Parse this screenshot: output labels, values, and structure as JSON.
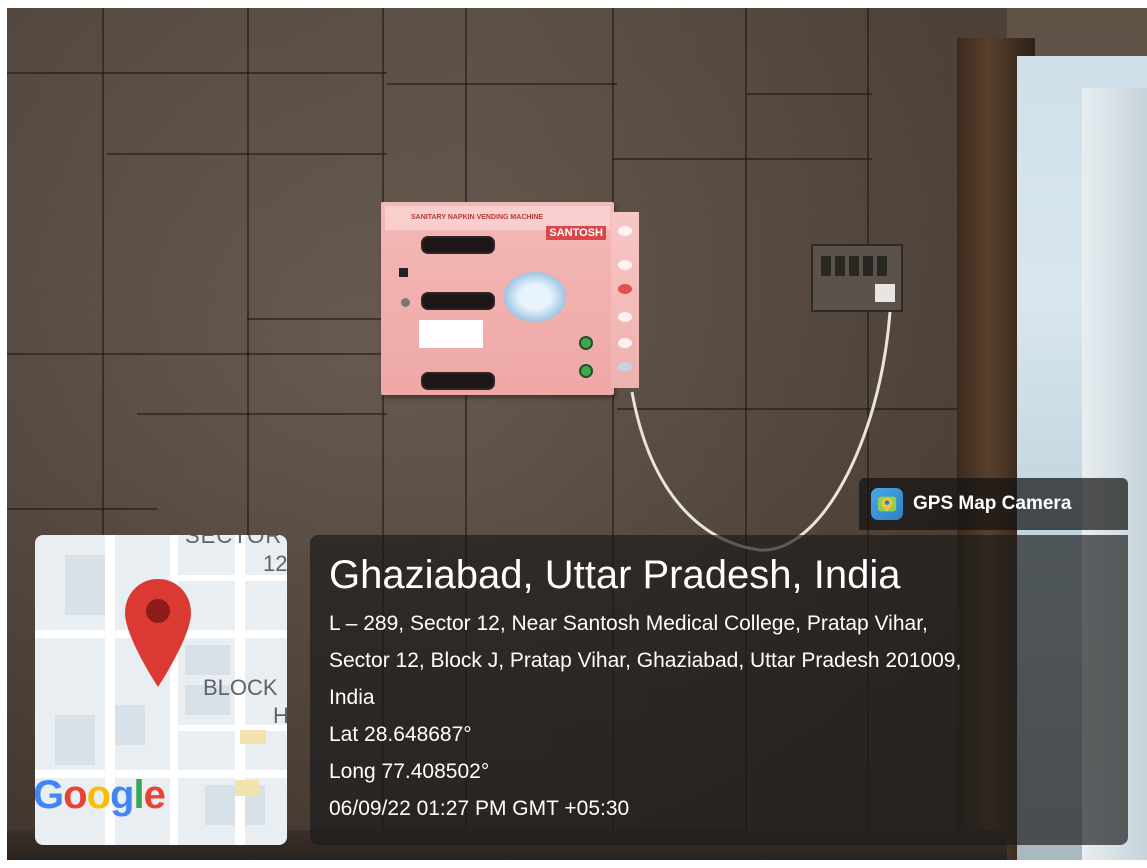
{
  "badge": {
    "icon": "gps-map-camera-icon",
    "label": "GPS Map Camera"
  },
  "map": {
    "labels": [
      "SECTOR",
      "12",
      "BLOCK",
      "H"
    ],
    "logo_text": "Google",
    "pin_color": "#DB3A34"
  },
  "location": {
    "place": "Ghaziabad, Uttar Pradesh, India",
    "address_lines": [
      "L – 289, Sector 12, Near Santosh Medical College, Pratap Vihar,",
      "Sector 12, Block J, Pratap Vihar, Ghaziabad, Uttar Pradesh 201009,",
      "India"
    ],
    "lat": "Lat 28.648687°",
    "long": "Long 77.408502°",
    "timestamp": "06/09/22 01:27 PM GMT +05:30"
  },
  "machine": {
    "header": "SANITARY NAPKIN VENDING MACHINE",
    "brand": "SANTOSH"
  }
}
